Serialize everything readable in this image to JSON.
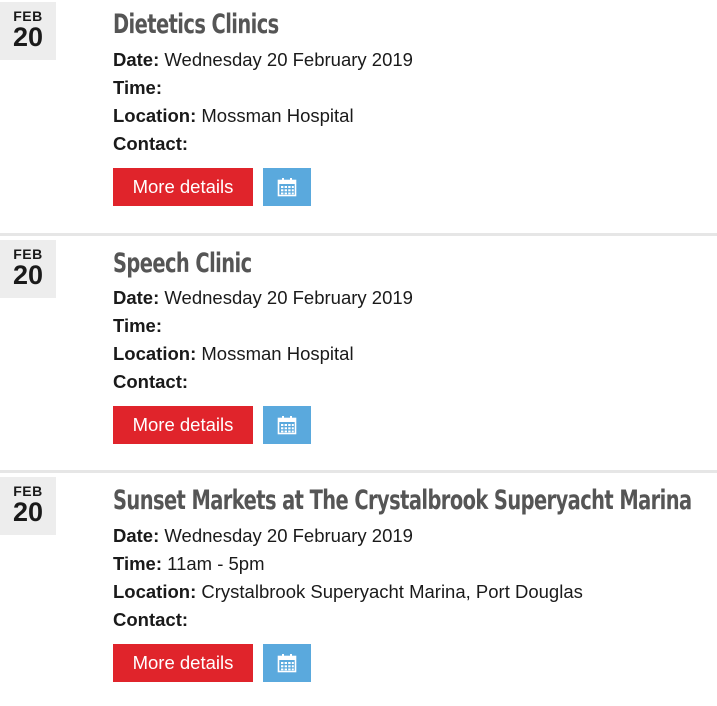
{
  "events": [
    {
      "month": "FEB",
      "day": "20",
      "title": "Dietetics Clinics",
      "date_label": "Date:",
      "date_value": " Wednesday 20 February 2019",
      "time_label": "Time:",
      "time_value": "",
      "location_label": "Location:",
      "location_value": " Mossman Hospital",
      "contact_label": "Contact:",
      "contact_value": "",
      "more_label": "More details",
      "calendar_icon": "calendar-icon"
    },
    {
      "month": "FEB",
      "day": "20",
      "title": "Speech Clinic",
      "date_label": "Date:",
      "date_value": " Wednesday 20 February 2019",
      "time_label": "Time:",
      "time_value": "",
      "location_label": "Location:",
      "location_value": " Mossman Hospital",
      "contact_label": "Contact:",
      "contact_value": "",
      "more_label": "More details",
      "calendar_icon": "calendar-icon"
    },
    {
      "month": "FEB",
      "day": "20",
      "title": "Sunset Markets at The Crystalbrook Superyacht Marina",
      "date_label": "Date:",
      "date_value": " Wednesday 20 February 2019",
      "time_label": "Time:",
      "time_value": " 11am - 5pm",
      "location_label": "Location:",
      "location_value": " Crystalbrook Superyacht Marina, Port Douglas",
      "contact_label": "Contact:",
      "contact_value": "",
      "more_label": "More details",
      "calendar_icon": "calendar-icon"
    }
  ],
  "colors": {
    "more_button": "#e0242b",
    "calendar_button": "#5aa9dd",
    "title": "#555555",
    "badge_bg": "#ededed",
    "divider": "#e6e6e6"
  }
}
